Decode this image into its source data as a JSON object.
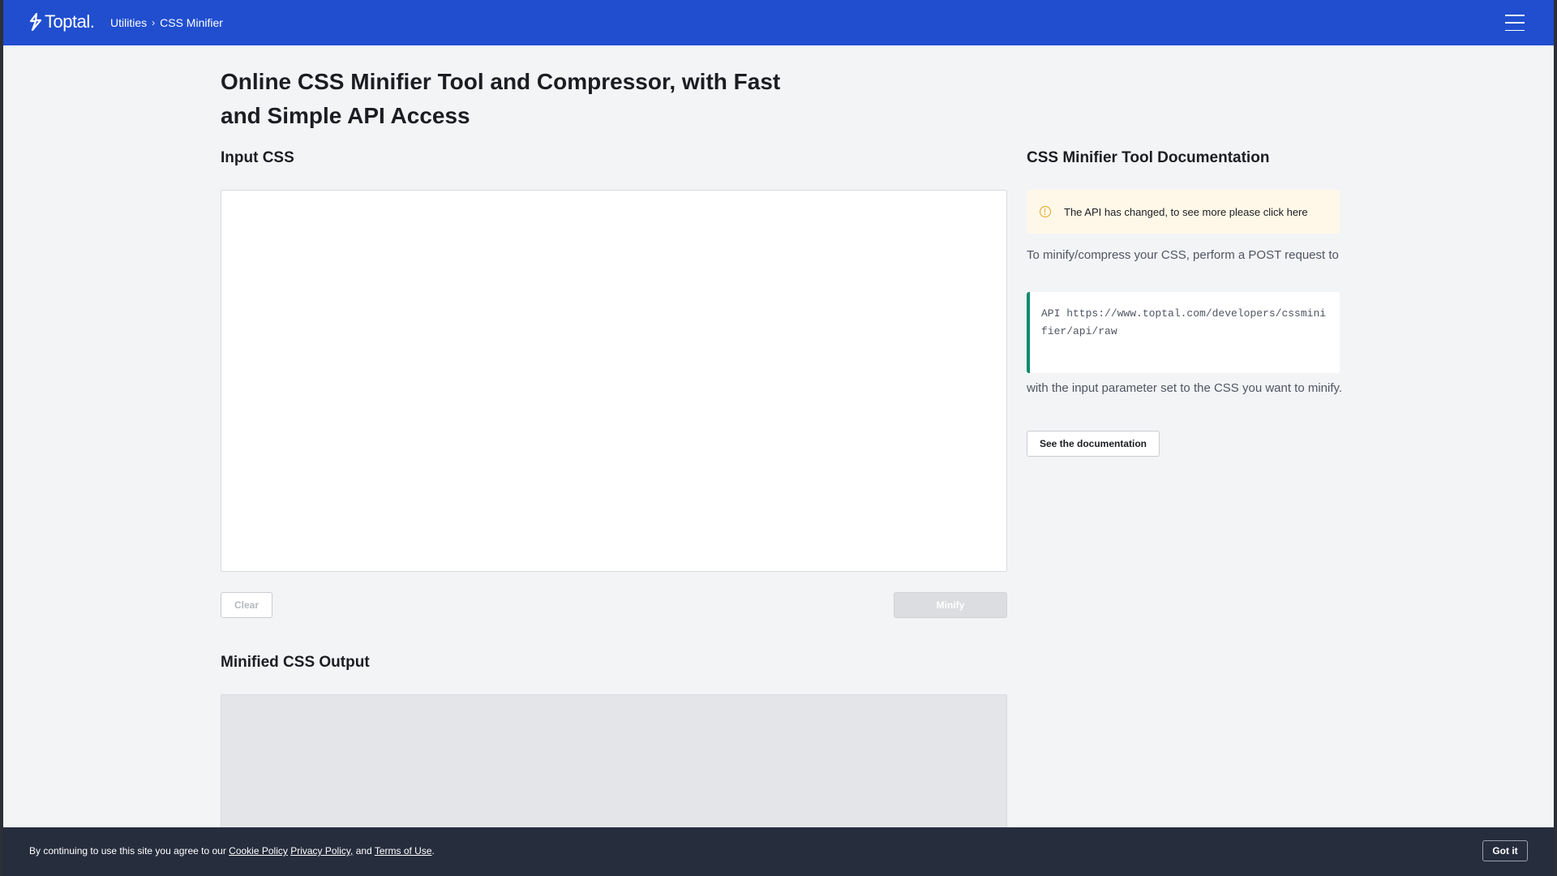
{
  "header": {
    "logo_text": "Toptal",
    "logo_dot": ".",
    "breadcrumb": [
      "Utilities",
      "CSS Minifier"
    ],
    "breadcrumb_separator": "›",
    "menu_icon": "hamburger-menu-icon"
  },
  "main": {
    "title": "Online CSS Minifier Tool and Compressor, with Fast and Simple API Access",
    "input_heading": "Input CSS",
    "input_value": "",
    "clear_label": "Clear",
    "minify_label": "Minify",
    "output_heading": "Minified CSS Output"
  },
  "sidebar": {
    "heading": "CSS Minifier Tool Documentation",
    "notice_icon": "warning-circle-icon",
    "notice_text": "The API has changed, to see more please click here",
    "intro_text": "To minify/compress your CSS, perform a POST request to",
    "code_text": "API https://www.toptal.com/developers/cssminifier/api/raw",
    "after_text": "with the input parameter set to the CSS you want to minify.",
    "docs_button": "See the documentation"
  },
  "cookie": {
    "prefix": "By continuing to use this site you agree to our",
    "cookie_policy": "Cookie Policy",
    "privacy_policy": "Privacy Policy,",
    "and": "and",
    "terms": "Terms of Use",
    "suffix": ".",
    "button": "Got it"
  },
  "colors": {
    "header_bg": "#204ecf",
    "page_bg": "#f3f4f6",
    "notice_bg": "#fff8e8",
    "code_accent": "#0a8c6d",
    "cookie_bg": "#262d3d"
  }
}
